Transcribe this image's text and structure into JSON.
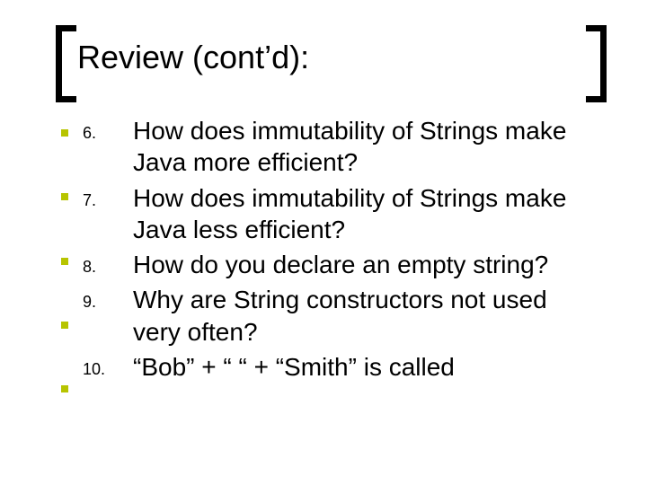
{
  "title": "Review (cont’d):",
  "items": [
    {
      "num": "6.",
      "text": "How does immutability of Strings make Java more efficient?"
    },
    {
      "num": "7.",
      "text": "How does immutability of Strings make Java less efficient?"
    },
    {
      "num": "8.",
      "text": "How do you declare an empty string?"
    },
    {
      "num": "9.",
      "text": "Why are String constructors not used very often?"
    },
    {
      "num": "10.",
      "text": "“Bob” + “ “ + “Smith” is called"
    }
  ]
}
